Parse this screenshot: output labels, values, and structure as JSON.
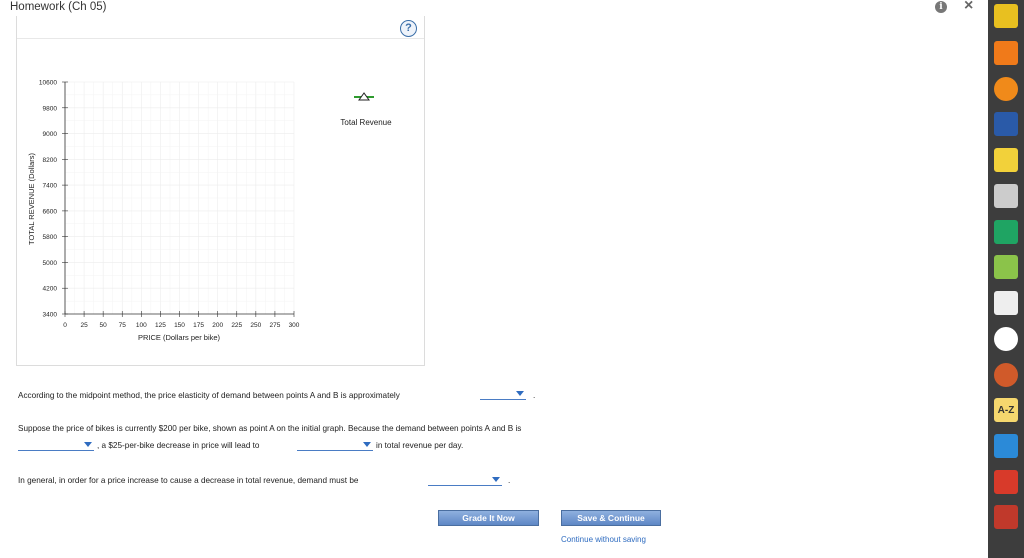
{
  "window": {
    "title": "Homework (Ch 05)",
    "close_glyph": "×",
    "info_glyph": "i"
  },
  "graph": {
    "help_glyph": "?",
    "legend": {
      "label": "Total Revenue",
      "color": "#2e9b2e",
      "marker": "triangle"
    }
  },
  "chart_data": {
    "type": "line",
    "xlabel": "PRICE (Dollars per bike)",
    "ylabel": "TOTAL REVENUE (Dollars)",
    "x_ticks": [
      "0",
      "25",
      "50",
      "75",
      "100",
      "125",
      "150",
      "175",
      "200",
      "225",
      "250",
      "275",
      "300"
    ],
    "y_ticks": [
      "3400",
      "4200",
      "5000",
      "5800",
      "6600",
      "7400",
      "8200",
      "9000",
      "9800",
      "10600"
    ],
    "xlim": [
      0,
      300
    ],
    "ylim": [
      3400,
      10600
    ],
    "grid": true,
    "legend_position": "top-right",
    "series": []
  },
  "questions": {
    "q1": "According to the midpoint method, the price elasticity of demand between points A and B is approximately",
    "q1_end": ".",
    "q2_line1": "Suppose the price of bikes is currently $200 per bike, shown as point A on the initial graph. Because the demand between points A and B is",
    "q2_mid": ", a $25-per-bike decrease in price will lead to",
    "q2_end": "in total revenue per day.",
    "q3": "In general, in order for a price increase to cause a decrease in total revenue, demand must be",
    "q3_end": "."
  },
  "actions": {
    "grade_label": "Grade It Now",
    "save_label": "Save & Continue",
    "continue_label": "Continue without saving"
  },
  "sidebar": {
    "items": [
      {
        "name": "pencil-icon",
        "color": "#e8c020"
      },
      {
        "name": "rss-icon",
        "color": "#f07a1a"
      },
      {
        "name": "timer-icon",
        "color": "#f08a1a"
      },
      {
        "name": "book-icon",
        "color": "#2a5aa8"
      },
      {
        "name": "notepad-icon",
        "color": "#f2d13a"
      },
      {
        "name": "speech-icon",
        "color": "#cccccc"
      },
      {
        "name": "google-drive-icon",
        "color": "#1fa463"
      },
      {
        "name": "shopping-cart-icon",
        "color": "#8bc34a"
      },
      {
        "name": "notes-icon",
        "color": "#eeeeee"
      },
      {
        "name": "colorwheel-icon",
        "color": "#ffffff"
      },
      {
        "name": "merriam-webster-icon",
        "color": "#d05a2a"
      },
      {
        "name": "a-z-icon",
        "color": "#f5d76e",
        "text": "A-Z"
      },
      {
        "name": "cloud-icon",
        "color": "#2b8ad8"
      },
      {
        "name": "cite-icon",
        "color": "#d83a2a"
      },
      {
        "name": "shield-icon",
        "color": "#c0392b"
      }
    ]
  }
}
